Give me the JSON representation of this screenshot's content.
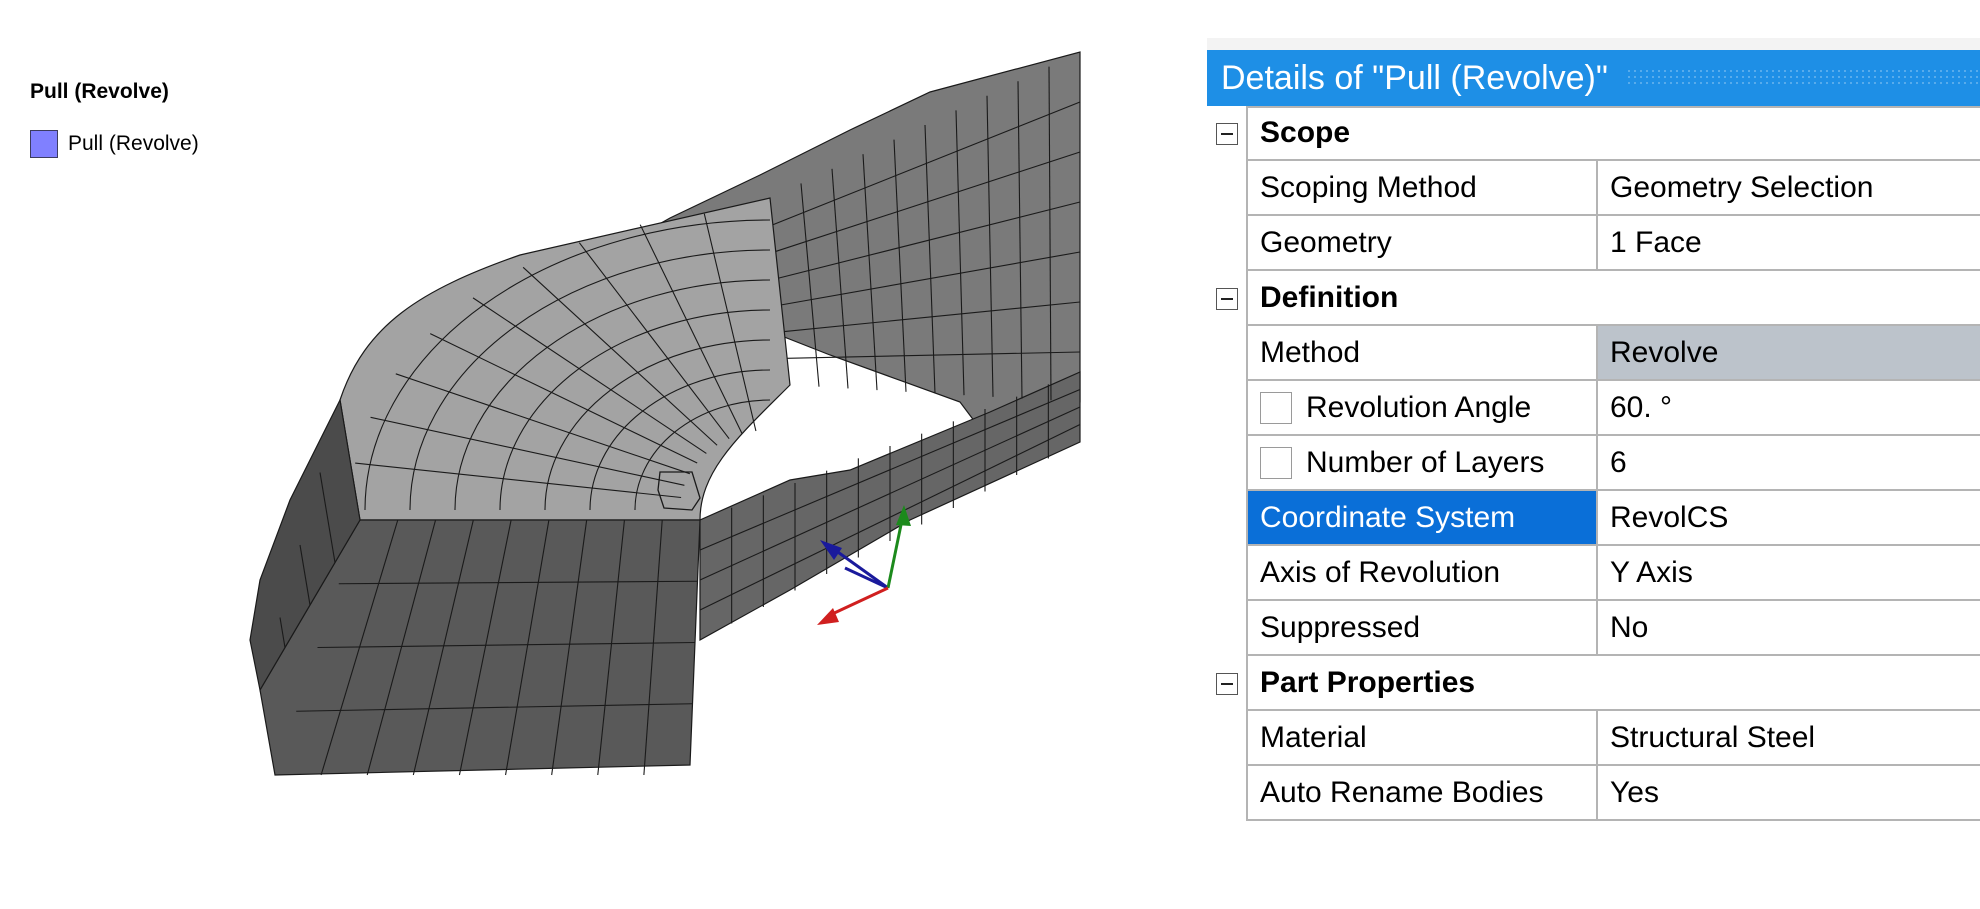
{
  "legend": {
    "title": "Pull (Revolve)",
    "item_label": "Pull (Revolve)",
    "item_color": "#8080ff"
  },
  "viewport": {
    "triad_colors": {
      "x": "#d01f1f",
      "y": "#1c8a1c",
      "z": "#1a1a9c"
    },
    "mesh_colors": {
      "face_light": "#a3a3a3",
      "face_mid": "#7a7a7a",
      "face_dark": "#595959",
      "face_darkest": "#4b4b4b",
      "edge": "#1a1a1a"
    }
  },
  "details": {
    "title": "Details of \"Pull (Revolve)\"",
    "sections": [
      {
        "name": "Scope",
        "rows": [
          {
            "label": "Scoping Method",
            "value": "Geometry Selection"
          },
          {
            "label": "Geometry",
            "value": "1 Face"
          }
        ]
      },
      {
        "name": "Definition",
        "rows": [
          {
            "label": "Method",
            "value": "Revolve"
          },
          {
            "label": "Revolution Angle",
            "value": "60. °"
          },
          {
            "label": "Number of Layers",
            "value": "6"
          },
          {
            "label": "Coordinate System",
            "value": "RevolCS"
          },
          {
            "label": "Axis of Revolution",
            "value": "Y Axis"
          },
          {
            "label": "Suppressed",
            "value": "No"
          }
        ]
      },
      {
        "name": "Part Properties",
        "rows": [
          {
            "label": "Material",
            "value": "Structural Steel"
          },
          {
            "label": "Auto Rename Bodies",
            "value": "Yes"
          }
        ]
      }
    ],
    "colors": {
      "header": "#1e8fe6",
      "selected": "#0a6fd8",
      "dropdown_value": "#bcc3cb"
    }
  }
}
